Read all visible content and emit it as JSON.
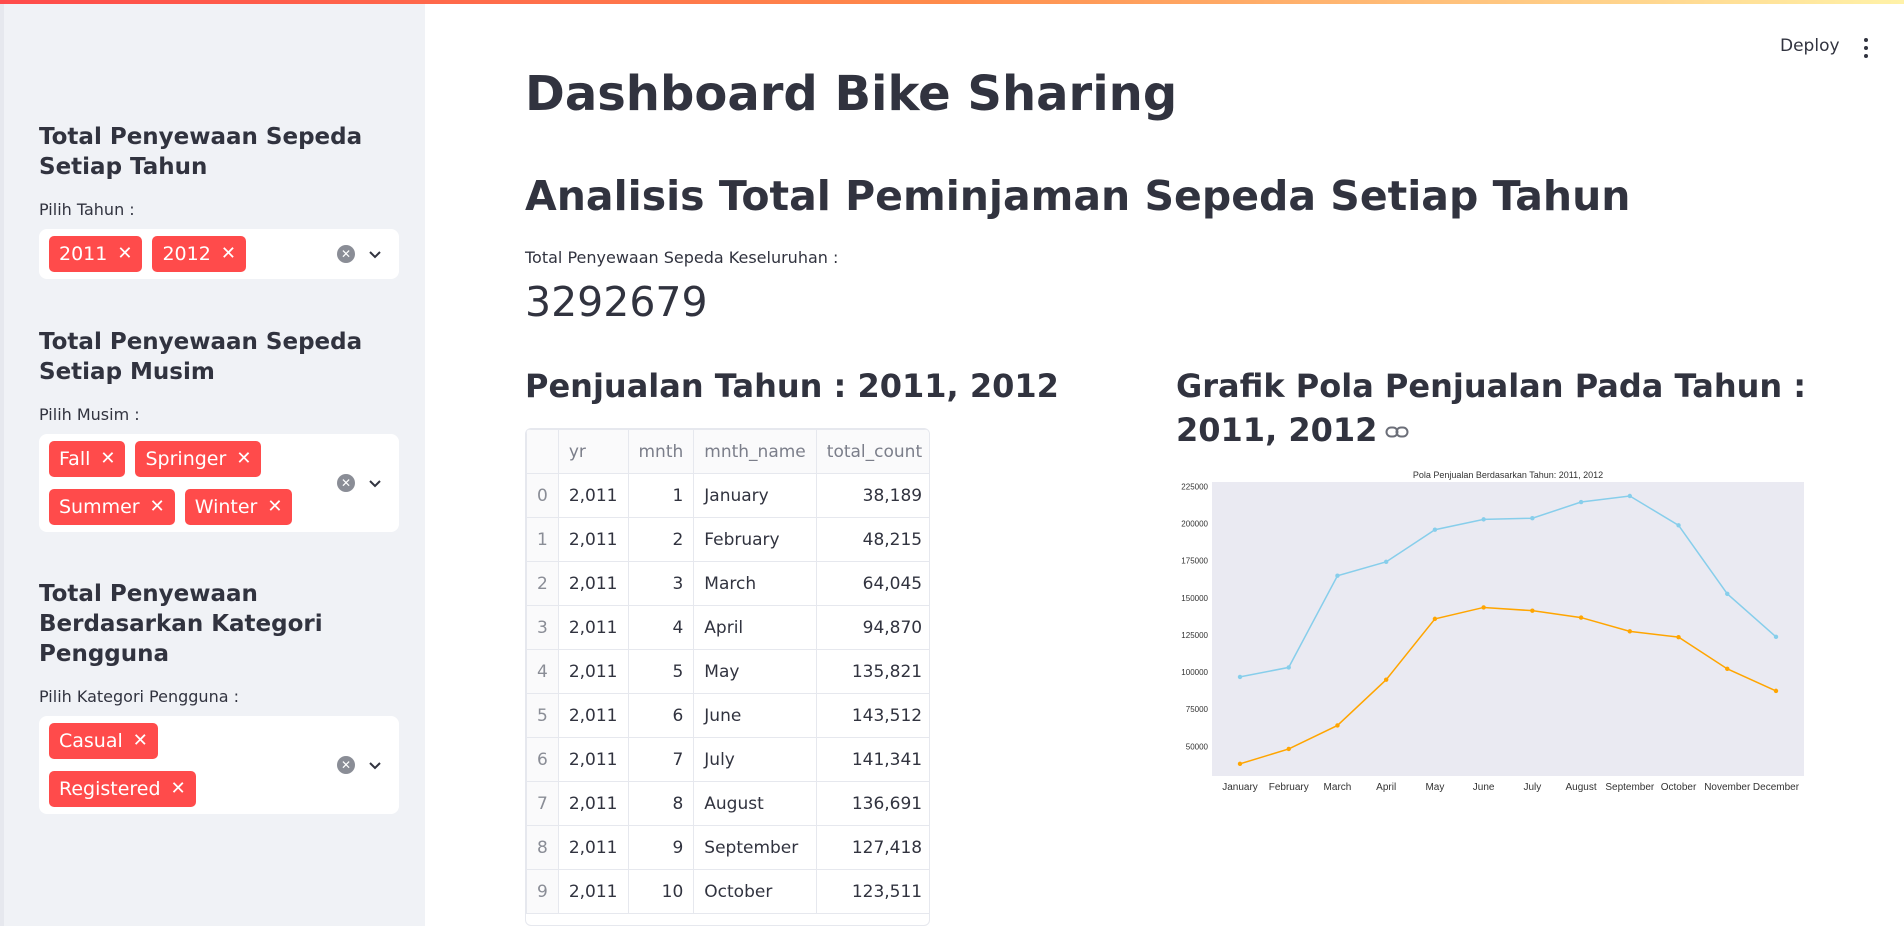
{
  "header": {
    "deploy_label": "Deploy"
  },
  "sidebar": {
    "sections": [
      {
        "heading": "Total Penyewaan Sepeda Setiap Tahun",
        "label": "Pilih Tahun :",
        "tags": [
          "2011",
          "2012"
        ]
      },
      {
        "heading": "Total Penyewaan Sepeda Setiap Musim",
        "label": "Pilih Musim :",
        "tags": [
          "Fall",
          "Springer",
          "Summer",
          "Winter"
        ]
      },
      {
        "heading": "Total Penyewaan Berdasarkan Kategori Pengguna",
        "label": "Pilih Kategori Pengguna :",
        "tags": [
          "Casual",
          "Registered"
        ]
      }
    ]
  },
  "main": {
    "title": "Dashboard Bike Sharing",
    "subtitle": "Analisis Total Peminjaman Sepeda Setiap Tahun",
    "metric": {
      "label": "Total Penyewaan Sepeda Keseluruhan :",
      "value": "3292679"
    },
    "table_heading": "Penjualan Tahun : 2011, 2012",
    "chart_heading": "Grafik Pola Penjualan Pada Tahun : 2011, 2012"
  },
  "table": {
    "columns": [
      "",
      "yr",
      "mnth",
      "mnth_name",
      "total_count"
    ],
    "rows": [
      [
        "0",
        "2,011",
        "1",
        "January",
        "38,189"
      ],
      [
        "1",
        "2,011",
        "2",
        "February",
        "48,215"
      ],
      [
        "2",
        "2,011",
        "3",
        "March",
        "64,045"
      ],
      [
        "3",
        "2,011",
        "4",
        "April",
        "94,870"
      ],
      [
        "4",
        "2,011",
        "5",
        "May",
        "135,821"
      ],
      [
        "5",
        "2,011",
        "6",
        "June",
        "143,512"
      ],
      [
        "6",
        "2,011",
        "7",
        "July",
        "141,341"
      ],
      [
        "7",
        "2,011",
        "8",
        "August",
        "136,691"
      ],
      [
        "8",
        "2,011",
        "9",
        "September",
        "127,418"
      ],
      [
        "9",
        "2,011",
        "10",
        "October",
        "123,511"
      ]
    ]
  },
  "chart_data": {
    "type": "line",
    "title": "Pola Penjualan Berdasarkan Tahun: 2011, 2012",
    "xlabel": "",
    "ylabel": "",
    "categories": [
      "January",
      "February",
      "March",
      "April",
      "May",
      "June",
      "July",
      "August",
      "September",
      "October",
      "November",
      "December"
    ],
    "series": [
      {
        "color": "#87ceeb",
        "values": [
          96744,
          103137,
          164875,
          174224,
          195865,
          202830,
          203607,
          214503,
          218573,
          198841,
          152664,
          123713
        ]
      },
      {
        "color": "#ffa500",
        "values": [
          38189,
          48215,
          64045,
          94870,
          135821,
          143512,
          141341,
          136691,
          127418,
          123511,
          102167,
          87323
        ]
      }
    ],
    "yticks": [
      "50000",
      "75000",
      "100000",
      "125000",
      "150000",
      "175000",
      "200000",
      "225000"
    ],
    "ylim": [
      30000,
      228000
    ],
    "grid": false,
    "plot_bg": "#eaeaf2"
  },
  "colors": {
    "accent": "#ff4b4b",
    "sidebar_bg": "#f0f2f6",
    "text": "#31333f"
  }
}
